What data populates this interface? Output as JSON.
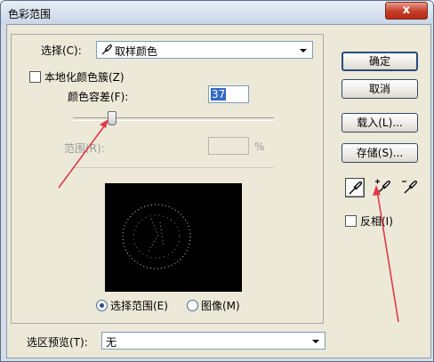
{
  "dialog": {
    "title": "色彩范围",
    "close_label": "x"
  },
  "select": {
    "label": "选择(C):",
    "value": "取样颜色"
  },
  "localized_clusters": {
    "label": "本地化颜色簇(Z)",
    "checked": false
  },
  "fuzziness": {
    "label": "颜色容差(F):",
    "value": "37",
    "slider_fraction": 0.19
  },
  "range": {
    "label": "范围(R):",
    "value": "",
    "unit": "%"
  },
  "view": {
    "selection_label": "选择范围(E)",
    "image_label": "图像(M)",
    "selected": "selection"
  },
  "preview": {
    "label": "选区预览(T):",
    "value": "无"
  },
  "buttons": {
    "ok": "确定",
    "cancel": "取消",
    "load": "载入(L)...",
    "save": "存储(S)..."
  },
  "invert": {
    "label": "反相(I)",
    "checked": false
  },
  "colors": {
    "annotation_arrow": "#e03a4a",
    "preview_bg": "#000000"
  }
}
